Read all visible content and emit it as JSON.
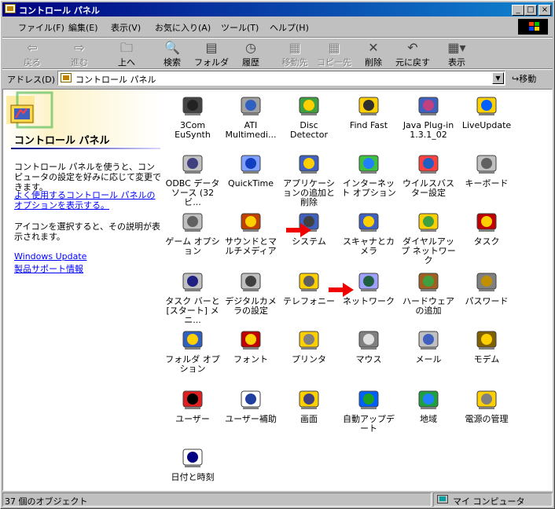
{
  "window": {
    "title": "コントロール パネル"
  },
  "menu": [
    "ファイル(F)",
    "編集(E)",
    "表示(V)",
    "お気に入り(A)",
    "ツール(T)",
    "ヘルプ(H)"
  ],
  "toolbar": {
    "back": "戻る",
    "forward": "進む",
    "up": "上へ",
    "search": "検索",
    "folders": "フォルダ",
    "history": "履歴",
    "moveto": "移動先",
    "copyto": "コピー先",
    "delete": "削除",
    "undo": "元に戻す",
    "views": "表示"
  },
  "address": {
    "label": "アドレス(D)",
    "value": "コントロール パネル",
    "go": "移動"
  },
  "left_pane": {
    "title": "コントロール パネル",
    "description": "コントロール パネルを使うと、コンピュータの設定を好みに応じて変更できます。",
    "link_options": "よく使用するコントロール パネルのオプションを表示する。",
    "hint": "アイコンを選択すると、その説明が表示されます。",
    "link_update": "Windows Update",
    "link_support": "製品サポート情報"
  },
  "icons": [
    [
      "3Com EuSynth",
      "ATI Multimedi...",
      "Disc Detector",
      "Find Fast",
      "Java Plug-in 1.3.1_02",
      "LiveUpdate"
    ],
    [
      "ODBC データ ソース (32ビ...",
      "QuickTime",
      "アプリケーションの追加と削除",
      "インターネット オプション",
      "ウイルスバスター設定",
      "キーボード"
    ],
    [
      "ゲーム オプション",
      "サウンドとマルチメディア",
      "システム",
      "スキャナとカメラ",
      "ダイヤルアップ ネットワーク",
      "タスク"
    ],
    [
      "タスク バーと [スタート] メニ...",
      "デジタルカメラの設定",
      "テレフォニー",
      "ネットワーク",
      "ハードウェアの追加",
      "パスワード"
    ],
    [
      "フォルダ オプション",
      "フォント",
      "プリンタ",
      "マウス",
      "メール",
      "モデム"
    ],
    [
      "ユーザー",
      "ユーザー補助",
      "画面",
      "自動アップデート",
      "地域",
      "電源の管理"
    ],
    [
      "日付と時刻"
    ]
  ],
  "status": {
    "count": "37 個のオブジェクト",
    "zone": "マイ コンピュータ"
  }
}
